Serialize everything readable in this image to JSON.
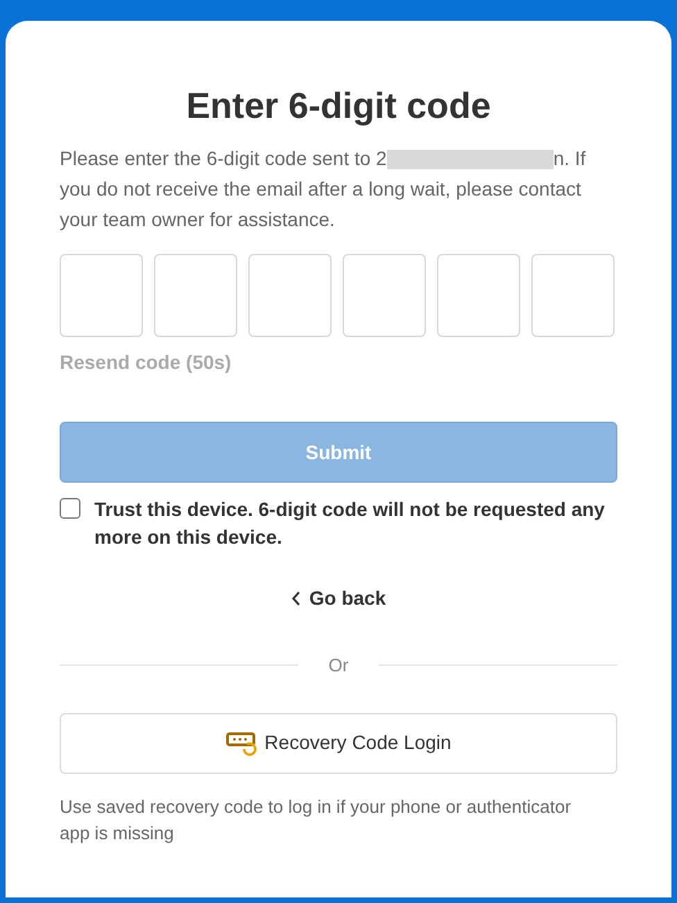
{
  "title": "Enter 6-digit code",
  "description": {
    "before": "Please enter the 6-digit code sent to 2",
    "after": "n. If you do not receive the email after a long wait, please contact your team owner for assistance."
  },
  "code_fields": [
    {
      "focused": false
    },
    {
      "focused": false
    },
    {
      "focused": false
    },
    {
      "focused": false
    },
    {
      "focused": false
    },
    {
      "focused": false
    }
  ],
  "resend": {
    "label": "Resend code (50s)",
    "disabled": true
  },
  "submit": {
    "label": "Submit",
    "disabled": true
  },
  "trust_device": {
    "label": "Trust this device. 6-digit code will not be requested any more on this device.",
    "checked": false
  },
  "go_back": {
    "label": "Go back"
  },
  "divider": {
    "label": "Or"
  },
  "recovery_button": {
    "label": "Recovery Code Login"
  },
  "recovery_hint": "Use saved recovery code to log in if your phone or authenticator app is missing"
}
